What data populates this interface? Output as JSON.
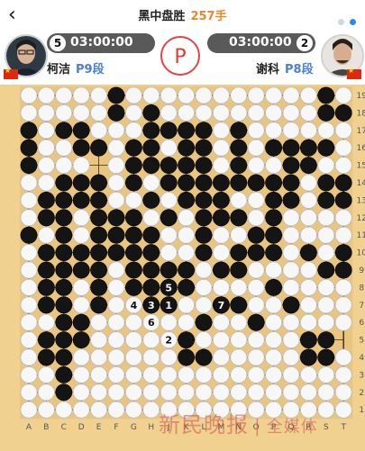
{
  "header": {
    "title": "黑中盘胜",
    "move_count": "257手",
    "page_indicator": {
      "count": 2,
      "active": 0
    }
  },
  "players": {
    "black": {
      "name": "柯洁",
      "rank": "P9段",
      "clock": "03:00:00",
      "captures": "5",
      "flag": "cn-flag-icon",
      "avatar": "avatar"
    },
    "white": {
      "name": "谢科",
      "rank": "P8段",
      "clock": "03:00:00",
      "captures": "2",
      "flag": "cn-flag-icon",
      "avatar": "avatar"
    }
  },
  "pass_button": {
    "label": "P"
  },
  "board": {
    "size": 19,
    "columns": [
      "A",
      "B",
      "C",
      "D",
      "E",
      "F",
      "G",
      "H",
      "J",
      "K",
      "L",
      "M",
      "N",
      "O",
      "P",
      "Q",
      "R",
      "S",
      "T"
    ],
    "rows": [
      "19",
      "18",
      "17",
      "16",
      "15",
      "14",
      "13",
      "12",
      "11",
      "10",
      "9",
      "8",
      "7",
      "6",
      "5",
      "4",
      "3",
      "2",
      "1"
    ],
    "stars": [
      "D4",
      "K4",
      "Q4",
      "D10",
      "K10",
      "Q10",
      "D16",
      "K16",
      "Q16"
    ],
    "black_stones": [
      "F19",
      "S19",
      "F18",
      "H18",
      "S18",
      "T18",
      "A17",
      "B17",
      "C17",
      "D17",
      "H17",
      "J17",
      "K17",
      "L17",
      "N17",
      "A16",
      "D16",
      "E16",
      "G16",
      "H16",
      "K16",
      "L16",
      "N16",
      "P16",
      "Q16",
      "R16",
      "S16",
      "A15",
      "G15",
      "H15",
      "J15",
      "K15",
      "L15",
      "N15",
      "Q15",
      "R15",
      "C14",
      "D14",
      "E14",
      "G14",
      "J14",
      "K14",
      "L14",
      "M14",
      "N14",
      "O14",
      "P14",
      "Q14",
      "S14",
      "T14",
      "B13",
      "C13",
      "D13",
      "E13",
      "H13",
      "K13",
      "L13",
      "M13",
      "P13",
      "Q13",
      "S13",
      "T13",
      "B12",
      "C12",
      "E12",
      "F12",
      "G12",
      "J12",
      "L12",
      "M12",
      "N12",
      "P12",
      "A11",
      "C11",
      "E11",
      "F11",
      "G11",
      "H11",
      "L11",
      "O11",
      "P11",
      "B10",
      "C10",
      "D10",
      "E10",
      "F10",
      "G10",
      "H10",
      "L10",
      "N10",
      "O10",
      "P10",
      "R10",
      "T10",
      "B9",
      "C9",
      "D9",
      "E9",
      "G9",
      "H9",
      "J9",
      "K9",
      "M9",
      "N9",
      "S9",
      "T9",
      "B8",
      "C8",
      "E8",
      "G8",
      "H8",
      "J8",
      "K8",
      "P8",
      "B7",
      "C7",
      "E7",
      "J7",
      "M7",
      "N7",
      "Q7",
      "C6",
      "D6",
      "L6",
      "O6",
      "B5",
      "C5",
      "D5",
      "K5",
      "R5",
      "S5",
      "B4",
      "C4",
      "K4",
      "L4",
      "R4",
      "S4",
      "C3",
      "C2"
    ],
    "white_stones": [
      "A19",
      "B19",
      "C19",
      "D19",
      "E19",
      "G19",
      "H19",
      "J19",
      "K19",
      "L19",
      "M19",
      "N19",
      "O19",
      "P19",
      "Q19",
      "R19",
      "T19",
      "A18",
      "B18",
      "C18",
      "D18",
      "E18",
      "G18",
      "J18",
      "K18",
      "L18",
      "M18",
      "N18",
      "O18",
      "P18",
      "Q18",
      "R18",
      "B17",
      "E17",
      "F17",
      "G17",
      "M17",
      "O17",
      "P17",
      "Q17",
      "R17",
      "S17",
      "T17",
      "B16",
      "C16",
      "F16",
      "J16",
      "M16",
      "O16",
      "T16",
      "B15",
      "C15",
      "D15",
      "F15",
      "M15",
      "O15",
      "P15",
      "S15",
      "T15",
      "A14",
      "B14",
      "F14",
      "H14",
      "R14",
      "A13",
      "F13",
      "G13",
      "J13",
      "N13",
      "O13",
      "R13",
      "A12",
      "D12",
      "H12",
      "K12",
      "O12",
      "Q12",
      "R12",
      "S12",
      "T12",
      "B11",
      "D11",
      "J11",
      "K11",
      "M11",
      "N11",
      "Q11",
      "R11",
      "S11",
      "T11",
      "A10",
      "J10",
      "K10",
      "M10",
      "Q10",
      "S10",
      "A9",
      "F9",
      "L9",
      "O9",
      "P9",
      "Q9",
      "R9",
      "A8",
      "D8",
      "F8",
      "L8",
      "M8",
      "N8",
      "O8",
      "Q8",
      "R8",
      "S8",
      "T8",
      "A7",
      "D7",
      "F7",
      "G7",
      "K7",
      "L7",
      "O7",
      "P7",
      "R7",
      "S7",
      "T7",
      "A6",
      "B6",
      "E6",
      "F6",
      "G6",
      "J6",
      "K6",
      "M6",
      "N6",
      "P6",
      "Q6",
      "R6",
      "S6",
      "T6",
      "A5",
      "E5",
      "F5",
      "G5",
      "H5",
      "J5",
      "L5",
      "M5",
      "N5",
      "O5",
      "P5",
      "Q5",
      "A4",
      "D4",
      "E4",
      "F4",
      "G4",
      "H4",
      "J4",
      "M4",
      "N4",
      "O4",
      "P4",
      "Q4",
      "T4",
      "A3",
      "B3",
      "D3",
      "E3",
      "F3",
      "G3",
      "H3",
      "J3",
      "K3",
      "L3",
      "M3",
      "N3",
      "O3",
      "P3",
      "Q3",
      "R3",
      "S3",
      "T3",
      "A2",
      "B2",
      "D2",
      "E2",
      "F2",
      "G2",
      "H2",
      "J2",
      "K2",
      "L2",
      "M2",
      "N2",
      "O2",
      "P2",
      "Q2",
      "R2",
      "S2",
      "T2",
      "A1",
      "B1",
      "C1",
      "D1",
      "E1",
      "F1",
      "G1",
      "H1",
      "J1",
      "K1",
      "L1",
      "M1",
      "N1",
      "O1",
      "P1",
      "Q1",
      "R1",
      "S1",
      "T1"
    ],
    "numbered": [
      {
        "label": "1",
        "color": "black",
        "point": "J7"
      },
      {
        "label": "2",
        "color": "white",
        "point": "J5"
      },
      {
        "label": "3",
        "color": "black",
        "point": "H7"
      },
      {
        "label": "4",
        "color": "white",
        "point": "G7"
      },
      {
        "label": "5",
        "color": "black",
        "point": "J8"
      },
      {
        "label": "6",
        "color": "white",
        "point": "H6"
      },
      {
        "label": "7",
        "color": "black",
        "point": "M7"
      }
    ]
  },
  "watermark": {
    "main": "新民晚报",
    "sep": "|",
    "sub": "全媒体"
  },
  "colors": {
    "board": "#f1d18f",
    "moves_accent": "#e8882a",
    "rank": "#4a7fd6",
    "pass": "#e53935"
  }
}
